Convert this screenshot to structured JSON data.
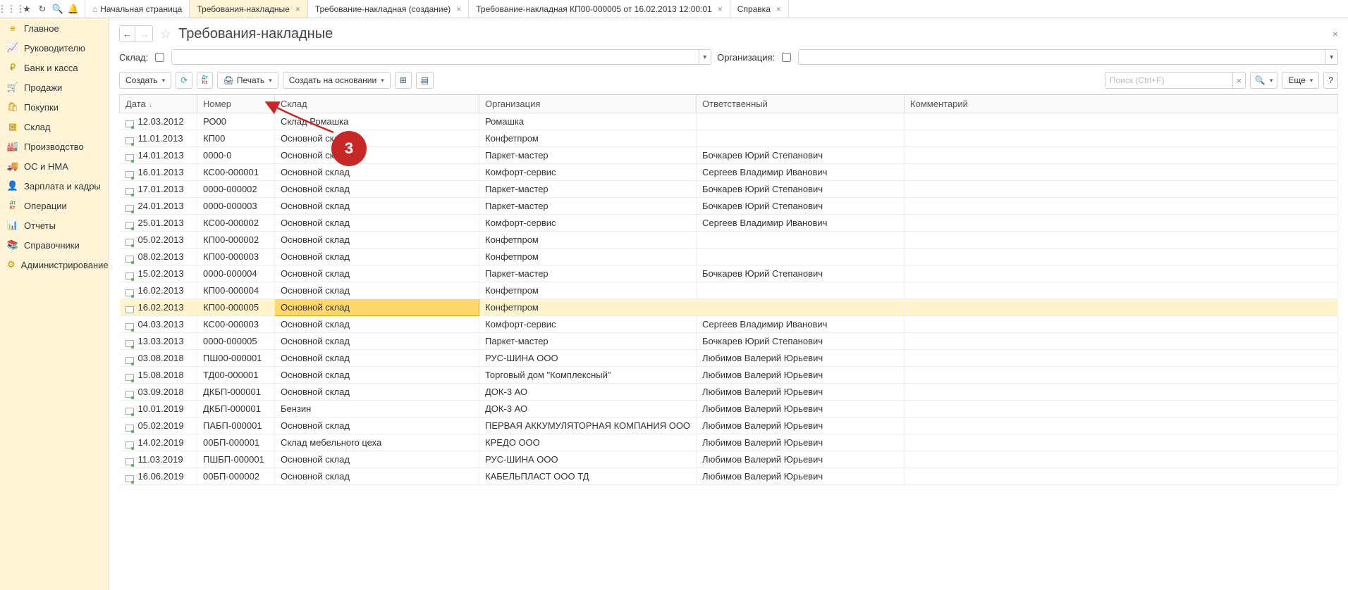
{
  "top_icons": [
    "apps",
    "star",
    "history",
    "search",
    "bell"
  ],
  "tabs": [
    {
      "label": "Начальная страница",
      "closable": false,
      "home": true
    },
    {
      "label": "Требования-накладные",
      "closable": true,
      "active": true
    },
    {
      "label": "Требование-накладная (создание)",
      "closable": true
    },
    {
      "label": "Требование-накладная КП00-000005 от 16.02.2013 12:00:01",
      "closable": true
    },
    {
      "label": "Справка",
      "closable": true
    }
  ],
  "sidebar": [
    {
      "label": "Главное",
      "icon": "≡"
    },
    {
      "label": "Руководителю",
      "icon": "📈"
    },
    {
      "label": "Банк и касса",
      "icon": "₽"
    },
    {
      "label": "Продажи",
      "icon": "🛒"
    },
    {
      "label": "Покупки",
      "icon": "🛍"
    },
    {
      "label": "Склад",
      "icon": "▦"
    },
    {
      "label": "Производство",
      "icon": "🏭"
    },
    {
      "label": "ОС и НМА",
      "icon": "🚚"
    },
    {
      "label": "Зарплата и кадры",
      "icon": "👤"
    },
    {
      "label": "Операции",
      "icon": "DtKt"
    },
    {
      "label": "Отчеты",
      "icon": "📊"
    },
    {
      "label": "Справочники",
      "icon": "📚"
    },
    {
      "label": "Администрирование",
      "icon": "⚙"
    }
  ],
  "page_title": "Требования-накладные",
  "filters": {
    "warehouse_label": "Склад:",
    "org_label": "Организация:"
  },
  "toolbar": {
    "create": "Создать",
    "print": "Печать",
    "create_based": "Создать на основании",
    "search_placeholder": "Поиск (Ctrl+F)",
    "more": "Еще"
  },
  "columns": [
    "Дата",
    "Номер",
    "Склад",
    "Организация",
    "Ответственный",
    "Комментарий"
  ],
  "rows": [
    {
      "posted": true,
      "date": "12.03.2012",
      "num": "РО00",
      "wh": "Склад Ромашка",
      "org": "Ромашка",
      "resp": "",
      "comment": ""
    },
    {
      "posted": true,
      "date": "11.01.2013",
      "num": "КП00",
      "wh": "Основной склад",
      "org": "Конфетпром",
      "resp": "",
      "comment": ""
    },
    {
      "posted": true,
      "date": "14.01.2013",
      "num": "0000-0",
      "wh": "Основной склад",
      "org": "Паркет-мастер",
      "resp": "Бочкарев Юрий Степанович",
      "comment": ""
    },
    {
      "posted": true,
      "date": "16.01.2013",
      "num": "КС00-000001",
      "wh": "Основной склад",
      "org": "Комфорт-сервис",
      "resp": "Сергеев Владимир Иванович",
      "comment": ""
    },
    {
      "posted": true,
      "date": "17.01.2013",
      "num": "0000-000002",
      "wh": "Основной склад",
      "org": "Паркет-мастер",
      "resp": "Бочкарев Юрий Степанович",
      "comment": ""
    },
    {
      "posted": true,
      "date": "24.01.2013",
      "num": "0000-000003",
      "wh": "Основной склад",
      "org": "Паркет-мастер",
      "resp": "Бочкарев Юрий Степанович",
      "comment": ""
    },
    {
      "posted": true,
      "date": "25.01.2013",
      "num": "КС00-000002",
      "wh": "Основной склад",
      "org": "Комфорт-сервис",
      "resp": "Сергеев Владимир Иванович",
      "comment": ""
    },
    {
      "posted": true,
      "date": "05.02.2013",
      "num": "КП00-000002",
      "wh": "Основной склад",
      "org": "Конфетпром",
      "resp": "",
      "comment": ""
    },
    {
      "posted": true,
      "date": "08.02.2013",
      "num": "КП00-000003",
      "wh": "Основной склад",
      "org": "Конфетпром",
      "resp": "",
      "comment": ""
    },
    {
      "posted": true,
      "date": "15.02.2013",
      "num": "0000-000004",
      "wh": "Основной склад",
      "org": "Паркет-мастер",
      "resp": "Бочкарев Юрий Степанович",
      "comment": ""
    },
    {
      "posted": true,
      "date": "16.02.2013",
      "num": "КП00-000004",
      "wh": "Основной склад",
      "org": "Конфетпром",
      "resp": "",
      "comment": ""
    },
    {
      "posted": false,
      "selected": true,
      "date": "16.02.2013",
      "num": "КП00-000005",
      "wh": "Основной склад",
      "org": "Конфетпром",
      "resp": "",
      "comment": ""
    },
    {
      "posted": true,
      "date": "04.03.2013",
      "num": "КС00-000003",
      "wh": "Основной склад",
      "org": "Комфорт-сервис",
      "resp": "Сергеев Владимир Иванович",
      "comment": ""
    },
    {
      "posted": true,
      "date": "13.03.2013",
      "num": "0000-000005",
      "wh": "Основной склад",
      "org": "Паркет-мастер",
      "resp": "Бочкарев Юрий Степанович",
      "comment": ""
    },
    {
      "posted": true,
      "date": "03.08.2018",
      "num": "ПШ00-000001",
      "wh": "Основной склад",
      "org": "РУС-ШИНА ООО",
      "resp": "Любимов Валерий Юрьевич",
      "comment": ""
    },
    {
      "posted": true,
      "date": "15.08.2018",
      "num": "ТД00-000001",
      "wh": "Основной склад",
      "org": "Торговый дом \"Комплексный\"",
      "resp": "Любимов Валерий Юрьевич",
      "comment": ""
    },
    {
      "posted": true,
      "date": "03.09.2018",
      "num": "ДКБП-000001",
      "wh": "Основной склад",
      "org": "ДОК-3 АО",
      "resp": "Любимов Валерий Юрьевич",
      "comment": ""
    },
    {
      "posted": true,
      "date": "10.01.2019",
      "num": "ДКБП-000001",
      "wh": "Бензин",
      "org": "ДОК-3 АО",
      "resp": "Любимов Валерий Юрьевич",
      "comment": ""
    },
    {
      "posted": true,
      "date": "05.02.2019",
      "num": "ПАБП-000001",
      "wh": "Основной склад",
      "org": "ПЕРВАЯ АККУМУЛЯТОРНАЯ КОМПАНИЯ ООО",
      "resp": "Любимов Валерий Юрьевич",
      "comment": ""
    },
    {
      "posted": true,
      "date": "14.02.2019",
      "num": "00БП-000001",
      "wh": "Склад мебельного цеха",
      "org": "КРЕДО ООО",
      "resp": "Любимов Валерий Юрьевич",
      "comment": ""
    },
    {
      "posted": true,
      "date": "11.03.2019",
      "num": "ПШБП-000001",
      "wh": "Основной склад",
      "org": "РУС-ШИНА ООО",
      "resp": "Любимов Валерий Юрьевич",
      "comment": ""
    },
    {
      "posted": true,
      "date": "16.06.2019",
      "num": "00БП-000002",
      "wh": "Основной склад",
      "org": "КАБЕЛЬПЛАСТ ООО ТД",
      "resp": "Любимов Валерий Юрьевич",
      "comment": ""
    }
  ],
  "annotation_number": "3"
}
